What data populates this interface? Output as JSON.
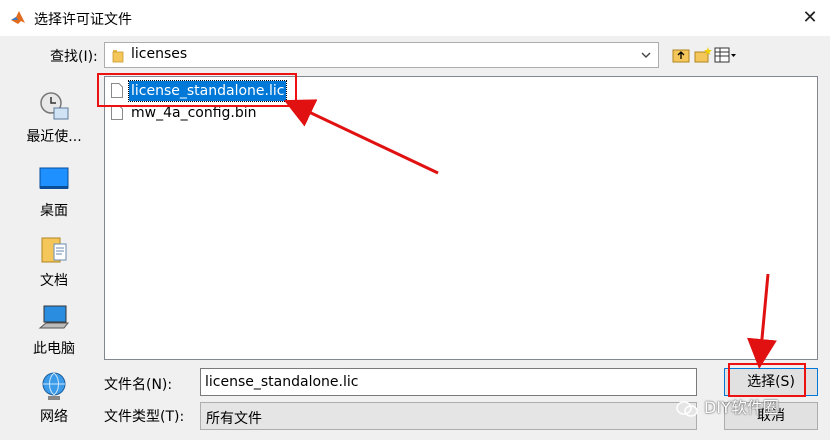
{
  "window": {
    "title": "选择许可证文件",
    "close_glyph": "✕"
  },
  "lookin": {
    "label": "查找(I):",
    "value": "licenses"
  },
  "places": [
    {
      "label": "最近使..."
    },
    {
      "label": "桌面"
    },
    {
      "label": "文档"
    },
    {
      "label": "此电脑"
    },
    {
      "label": "网络"
    }
  ],
  "files": [
    {
      "name": "license_standalone.lic",
      "selected": true
    },
    {
      "name": "mw_4a_config.bin",
      "selected": false
    }
  ],
  "filename": {
    "label": "文件名(N):",
    "value": "license_standalone.lic"
  },
  "filetype": {
    "label": "文件类型(T):",
    "value": "所有文件"
  },
  "buttons": {
    "select": "选择(S)",
    "cancel": "取消"
  },
  "watermark": {
    "text": "DIY软件圈"
  },
  "colors": {
    "selection": "#0078d7",
    "annotation": "#e11111"
  }
}
